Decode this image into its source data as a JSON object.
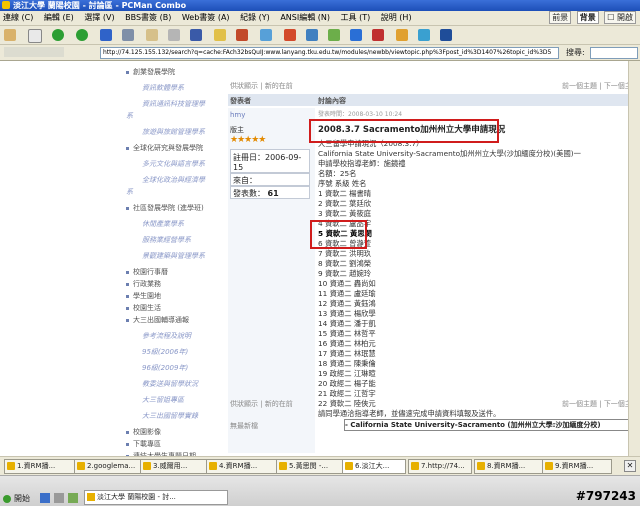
{
  "window": {
    "title": "淡江大學 蘭陽校園 - 討論區 - PCMan Combo"
  },
  "menu": [
    "連線 (C)",
    "編輯 (E)",
    "選擇 (V)",
    "BBS書簽 (B)",
    "Web書簽 (A)",
    "紀錄 (Y)",
    "ANSI編輯 (N)",
    "工具 (T)",
    "說明 (H)"
  ],
  "menu_right": {
    "prev": "前景",
    "bg": "背景",
    "close": "開啟"
  },
  "address": {
    "url": "http://74.125.155.132/search?q=cache:FAch32bsQuIJ:www.lanyang.tku.edu.tw/modules/newbb/viewtopic.php%3Fpost_id%3D1407%26topic_id%3D5",
    "search_label": "搜尋:"
  },
  "nav": [
    {
      "label": "創業發展學院",
      "level": 1
    },
    {
      "label": "資訊軟體學系",
      "level": 2
    },
    {
      "label": "資訊通訊科技管理學",
      "level": 2
    },
    {
      "label": "系",
      "level": 2
    },
    {
      "label": "旅遊與旅館管理學系",
      "level": 2
    },
    {
      "label": "全球化研究與發展學院",
      "level": 1
    },
    {
      "label": "多元文化與語言學系",
      "level": 2
    },
    {
      "label": "全球化政治與經濟學",
      "level": 2
    },
    {
      "label": "系",
      "level": 2
    },
    {
      "label": "社區發展學院 (進學班)",
      "level": 1
    },
    {
      "label": "休閒產業學系",
      "level": 2
    },
    {
      "label": "服務業經營學系",
      "level": 2
    },
    {
      "label": "景觀建築與管理學系",
      "level": 2
    },
    {
      "label": "校園行事曆",
      "level": 1
    },
    {
      "label": "行政業務",
      "level": 1
    },
    {
      "label": "學生園地",
      "level": 1
    },
    {
      "label": "校園生活",
      "level": 1
    },
    {
      "label": "大三出國輔導通報",
      "level": 1
    },
    {
      "label": "參考流程及說明",
      "level": 2
    },
    {
      "label": "95級(2006年)",
      "level": 2
    },
    {
      "label": "96級(2009年)",
      "level": 2
    },
    {
      "label": "教委送與留學狀況",
      "level": 2
    },
    {
      "label": "大三留姐專區",
      "level": 2
    },
    {
      "label": "大三出國留學實錄",
      "level": 2
    },
    {
      "label": "校園影像",
      "level": 1
    },
    {
      "label": "下載專區",
      "level": 1
    },
    {
      "label": "連結大學生專題日期",
      "level": 1
    }
  ],
  "forum": {
    "top_links": {
      "flat": "供狀顯示",
      "newest": "新的在前",
      "prev_topic": "前一個主題",
      "next_topic": "下一個主"
    },
    "col_author": "發表者",
    "col_content": "討論內容",
    "author": "hmy",
    "rank": "版主",
    "stars": 5,
    "register_label": "註冊日：",
    "register_date": "2006-09-15",
    "from_label": "來自：",
    "posts_label": "發表數：",
    "posts_count": "61",
    "posted_at": "發表時間：2008-03-10 10:24",
    "subject": "2008.3.7 Sacramento加州州立大學申請現況",
    "body": [
      "大三留學申請現況（2008.3.7）",
      "California State University-Sacramento加州州立大學(沙加緬度分校)(美國)一",
      "申請學校指導老師：施鏡禮",
      "名額：25名",
      "序號 系級 姓名",
      "1 資軟二 楊書晴",
      "2 資軟二 葉廷欣",
      "3 資軟二 黃筱庭",
      "4 資軟二 盧品宇",
      "5 資軟二 黃思閔",
      "6 資軟二 曾瀞萱",
      "7 資軟二 洪明玖",
      "8 資軟二 劉鴻榮",
      "9 資軟二 趙婉玲",
      "10 資通二 轟尚如",
      "11 資通二 盧廷瑜",
      "12 資通二 黃鈺鴻",
      "13 資通二 楊欣學",
      "14 資通二 潘于凱",
      "15 資通二 林哲平",
      "16 資通二 林柏元",
      "17 資通二 林珉慧",
      "18 資通二 陳秉倫",
      "19 政經二 江琳暄",
      "20 政經二 楊子能",
      "21 政經二 江哲宇",
      "22 資軟二 陸俠元",
      "請同學通洽指導老師，並儘速完成申請資料填報及送件。"
    ],
    "bottom_links": {
      "flat": "供狀顯示",
      "newest": "新的在前",
      "prev_topic": "前一個主題",
      "next_topic": "下一個主"
    },
    "bottom_left": "無最新檔",
    "bottom_select": "- California State University-Sacramento (加州州立大學:沙加緬度分校)"
  },
  "tabs": [
    {
      "label": "1.資RM播..."
    },
    {
      "label": "2.googlema..."
    },
    {
      "label": "3.威爾用..."
    },
    {
      "label": "4.資RM播..."
    },
    {
      "label": "5.黃思閔 -..."
    },
    {
      "label": "6.淡江大..."
    },
    {
      "label": "7.http://74..."
    },
    {
      "label": "8.資RM播..."
    },
    {
      "label": "9.資RM播..."
    }
  ],
  "taskbar": {
    "start": "開始",
    "window_button": "淡江大學 蘭陽校園 - 討...",
    "watermark": "#797243"
  }
}
